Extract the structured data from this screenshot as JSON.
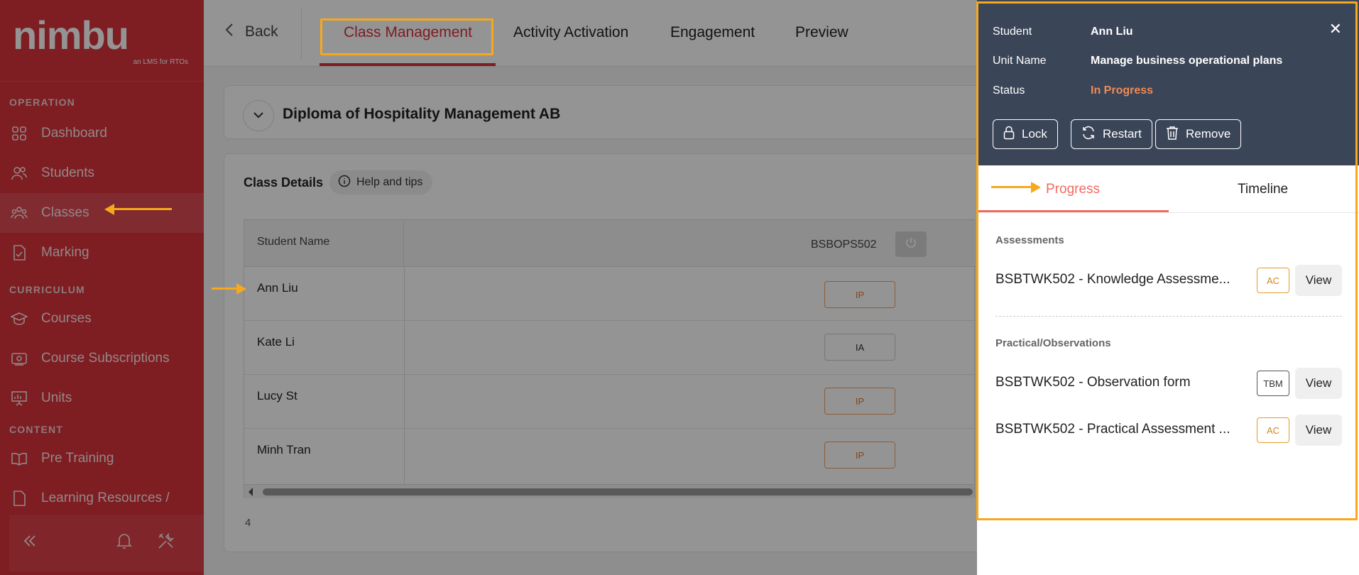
{
  "sidebar": {
    "logo_text": "nimbu",
    "logo_sub": "an LMS for RTOs",
    "sections": {
      "operation": "OPERATION",
      "curriculum": "CURRICULUM",
      "content": "CONTENT"
    },
    "items": {
      "dashboard": "Dashboard",
      "students": "Students",
      "classes": "Classes",
      "marking": "Marking",
      "courses": "Courses",
      "course_subscriptions": "Course Subscriptions",
      "units": "Units",
      "pre_training": "Pre Training",
      "learning_resources": "Learning Resources /"
    }
  },
  "topbar": {
    "back": "Back",
    "tabs": {
      "class_management": "Class Management",
      "activity_activation": "Activity Activation",
      "engagement": "Engagement",
      "preview": "Preview"
    }
  },
  "main": {
    "course_title": "Diploma of Hospitality Management AB",
    "class_details": "Class Details",
    "help_tips": "Help and tips",
    "table": {
      "col_student": "Student Name",
      "col_unit": "BSBOPS502",
      "rows": [
        {
          "name": "Ann Liu",
          "status": "IP"
        },
        {
          "name": "Kate Li",
          "status": "IA"
        },
        {
          "name": "Lucy St",
          "status": "IP"
        },
        {
          "name": "Minh Tran",
          "status": "IP"
        }
      ]
    },
    "count": "4"
  },
  "drawer": {
    "student_label": "Student",
    "student_value": "Ann Liu",
    "unit_label": "Unit Name",
    "unit_value": "Manage business operational plans",
    "status_label": "Status",
    "status_value": "In Progress",
    "status_color": "#f28a55",
    "buttons": {
      "lock": "Lock",
      "restart": "Restart",
      "remove": "Remove"
    },
    "tabs": {
      "progress": "Progress",
      "timeline": "Timeline"
    },
    "assessments_label": "Assessments",
    "practical_label": "Practical/Observations",
    "view": "View",
    "assessments": [
      {
        "name": "BSBTWK502 - Knowledge Assessme...",
        "badge": "AC"
      }
    ],
    "practicals": [
      {
        "name": "BSBTWK502 - Observation form",
        "badge": "TBM"
      },
      {
        "name": "BSBTWK502 - Practical Assessment ...",
        "badge": "AC"
      }
    ]
  },
  "colors": {
    "brand_red": "#d9333c",
    "highlight": "#f7a81b",
    "drawer_header": "#3a4557"
  }
}
